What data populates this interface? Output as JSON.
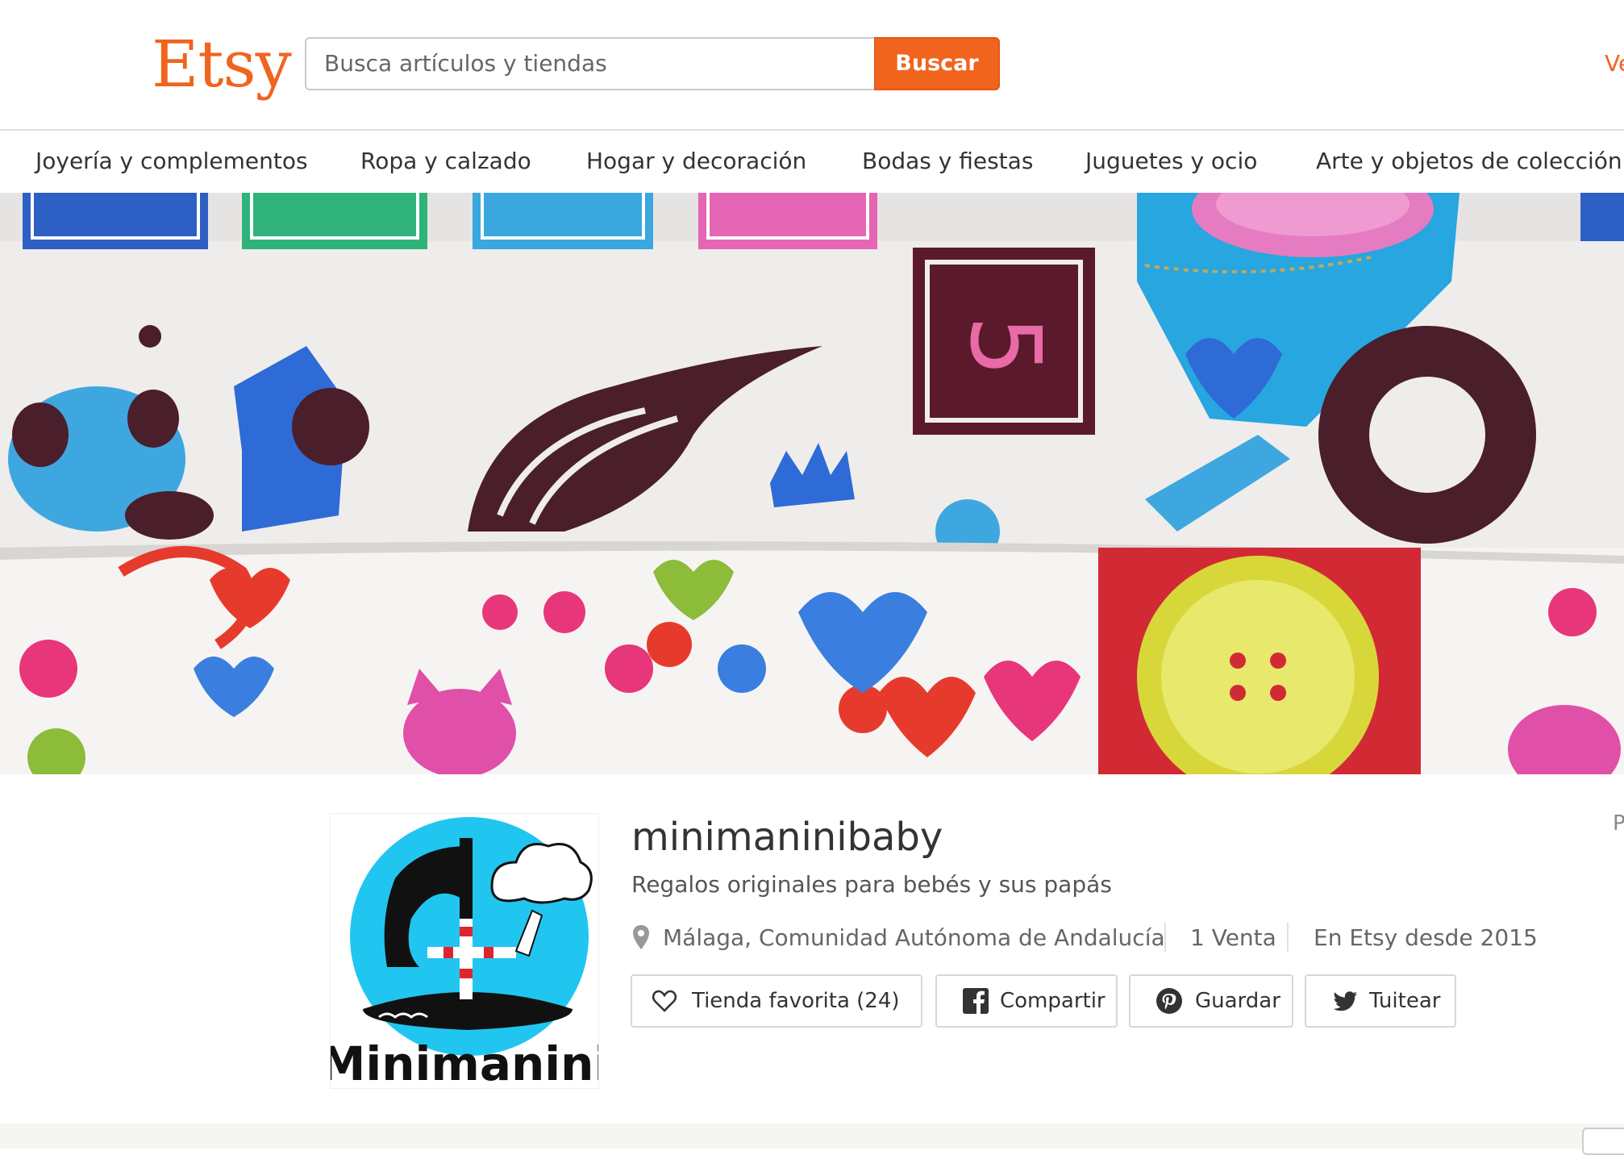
{
  "header": {
    "logo": "Etsy",
    "search_placeholder": "Busca artículos y tiendas",
    "search_button": "Buscar",
    "right_link": "Ve"
  },
  "categories": [
    {
      "label": "Joyería y complementos"
    },
    {
      "label": "Ropa y calzado"
    },
    {
      "label": "Hogar y decoración"
    },
    {
      "label": "Bodas y fiestas"
    },
    {
      "label": "Juguetes y ocio"
    },
    {
      "label": "Arte y objetos de colección"
    }
  ],
  "shop": {
    "logo_text": "Minimanini",
    "name": "minimaninibaby",
    "tagline": "Regalos originales para bebés y sus papás",
    "location": "Málaga, Comunidad Autónoma de Andalucía",
    "sales": "1 Venta",
    "since": "En Etsy desde 2015",
    "edge_text": "P"
  },
  "actions": {
    "favorite": "Tienda favorita (24)",
    "facebook": "Compartir",
    "pinterest": "Guardar",
    "twitter": "Tuitear"
  },
  "icons": {
    "favorite": "heart-outline-icon",
    "facebook": "facebook-icon",
    "pinterest": "pinterest-icon",
    "twitter": "twitter-icon",
    "location": "map-pin-icon"
  },
  "colors": {
    "brand": "#f1641e",
    "banner_fabric": "#f2f0ee",
    "avatar_circle": "#21c6f0"
  }
}
